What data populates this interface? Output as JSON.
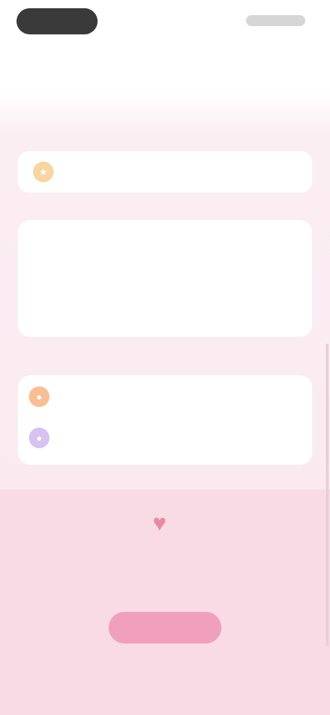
{
  "nav": {
    "title": ""
  },
  "recommend": {
    "caption": "",
    "label": "",
    "icon": "star-icon"
  },
  "info": {
    "rows": [
      "",
      "",
      ""
    ]
  },
  "friends": {
    "caption": "",
    "items": [
      {
        "label": "",
        "icon": "user-icon",
        "color": "#f8bf95"
      },
      {
        "label": "",
        "icon": "group-icon",
        "color": "#d8c2f2"
      }
    ]
  },
  "cta": {
    "text": "",
    "button_label": "",
    "footer": ""
  },
  "colors": {
    "accent": "#f0a0bd",
    "heart": "#e88aa6",
    "background": "#f9e8ee"
  }
}
